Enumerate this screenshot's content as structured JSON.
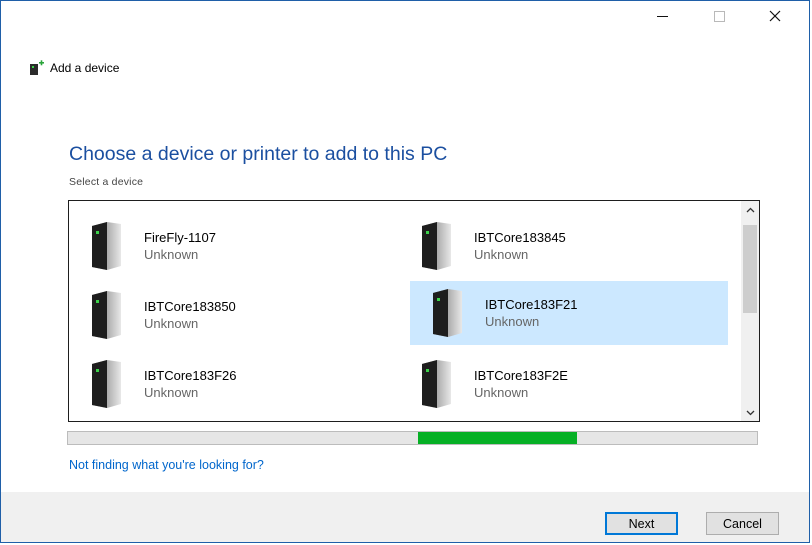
{
  "window": {
    "title": "Add a device",
    "controls": [
      "minimize-icon",
      "maximize-icon",
      "close-icon"
    ]
  },
  "main": {
    "heading": "Choose a device or printer to add to this PC",
    "sublabel": "Select a device"
  },
  "devices": [
    {
      "name": "FireFly-1107",
      "status": "Unknown",
      "icon": "bluetooth-device-icon",
      "selected": false
    },
    {
      "name": "IBTCore183845",
      "status": "Unknown",
      "icon": "bluetooth-device-icon",
      "selected": false
    },
    {
      "name": "IBTCore183850",
      "status": "Unknown",
      "icon": "bluetooth-device-icon",
      "selected": false
    },
    {
      "name": "IBTCore183F21",
      "status": "Unknown",
      "icon": "bluetooth-device-icon",
      "selected": true
    },
    {
      "name": "IBTCore183F26",
      "status": "Unknown",
      "icon": "bluetooth-device-icon",
      "selected": false
    },
    {
      "name": "IBTCore183F2E",
      "status": "Unknown",
      "icon": "bluetooth-device-icon",
      "selected": false
    }
  ],
  "progress": {
    "indeterminate": true,
    "fill_color": "#06b025"
  },
  "help_link": "Not finding what you're looking for?",
  "buttons": {
    "next": "Next",
    "cancel": "Cancel"
  },
  "colors": {
    "accent": "#1b4fa0",
    "link": "#0066cc",
    "selection": "#cce8ff"
  }
}
